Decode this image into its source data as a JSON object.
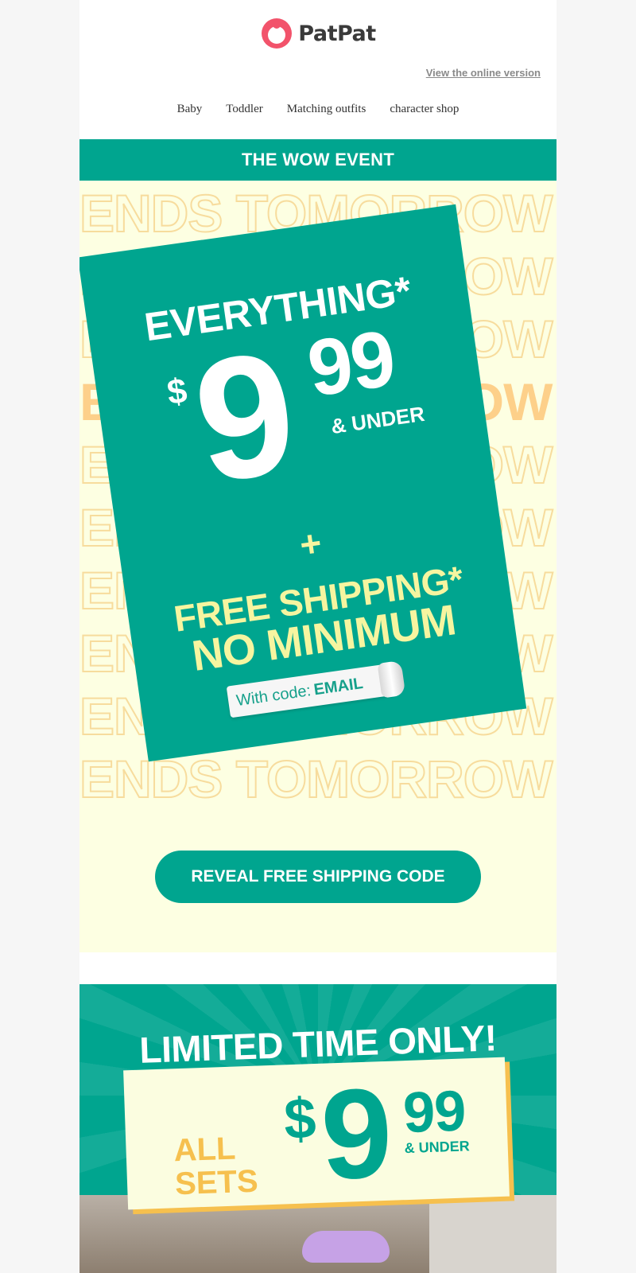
{
  "header": {
    "brand": "PatPat",
    "view_online": "View the online version",
    "nav": [
      "Baby",
      "Toddler",
      "Matching outfits",
      "character shop"
    ]
  },
  "event_bar": {
    "label": "THE WOW EVENT"
  },
  "hero": {
    "background_text": "ENDS TOMORROW",
    "headline": "EVERYTHING*",
    "price_dollar": "$",
    "price_whole": "9",
    "price_cents": "99",
    "price_suffix": "& UNDER",
    "plus": "+",
    "shipping_line1": "FREE SHIPPING*",
    "shipping_line2": "NO MINIMUM",
    "code_label": "With code:",
    "code_value": "EMAIL",
    "button_label": "REVEAL FREE SHIPPING CODE"
  },
  "banner2": {
    "headline": "LIMITED TIME ONLY!",
    "category_line1": "ALL",
    "category_line2": "SETS",
    "price_dollar": "$",
    "price_whole": "9",
    "price_cents": "99",
    "price_suffix": "& UNDER"
  },
  "colors": {
    "brand_green": "#00a58f",
    "hero_bg": "#fdffe2",
    "accent_yellow": "#f6f5a0",
    "gold": "#f6c04e",
    "logo_pink": "#f2536b"
  },
  "icons": {
    "logo": "patpat-logo-icon"
  }
}
